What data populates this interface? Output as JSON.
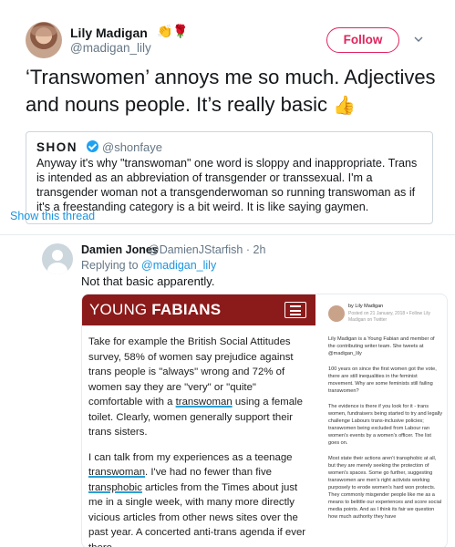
{
  "tweet": {
    "author_name": "Lily Madigan",
    "author_emoji": "👏🌹",
    "author_handle": "@madigan_lily",
    "follow_label": "Follow",
    "text": "‘Transwomen’ annoys me so much. Adjectives and nouns people. It’s really basic",
    "text_emoji": "👍"
  },
  "quote": {
    "name": "SHON",
    "handle": "@shonfaye",
    "text": "Anyway it's why \"transwoman\" one word is sloppy and inappropriate. Trans is intended as an abbreviation of transgender or transsexual. I'm a transgender woman not a transgenderwoman so running transwoman as if it's a freestanding category is a bit weird. It is like saying gaymen.",
    "show_thread": "Show this thread"
  },
  "reply": {
    "name": "Damien Jones",
    "handle": "@DamienJStarfish · 2h",
    "replying_prefix": "Replying to",
    "replying_handle": "@madigan_lily",
    "text": "Not that basic apparently."
  },
  "media": {
    "logo_light": "YOUNG ",
    "logo_bold": "FABIANS",
    "p1_a": "Take for example the British Social Attitudes survey, 58% of women say prejudice against trans people is \"always\" wrong and 72% of women say they are \"very\" or \"quite\" comfortable with a ",
    "p1_ul": "transwoman",
    "p1_b": " using a female toilet. Clearly, women generally support their trans sisters.",
    "p2_a": "I can talk from my experiences as a teenage ",
    "p2_ul1": "transwoman",
    "p2_b": ". I've had no fewer than five ",
    "p2_ul2": "transphobic",
    "p2_c": " articles from the Times about just me in a single week, with many more directly vicious articles from other news sites over the past year. A concerted anti-trans agenda if ever there",
    "sb_by": "by Lily Madigan",
    "sb_meta": "Posted on 21 January, 2018 • Follow Lily Madigan on Twitter",
    "sb_p1": "Lily Madigan is a Young Fabian and member of the contributing writer team. She tweets at @madigan_lily",
    "sb_p2": "100 years on since the first women got the vote, there are still inequalities in the feminist movement. Why are some feminists still failing transwomen?",
    "sb_p3": "The evidence is there if you look for it - trans women, fundraisers being started to try and legally challenge Labours trans-inclusive policies; transwomen being excluded from Labour ran women's events by a women's officer. The list goes on.",
    "sb_p4": "Most state their actions aren't transphobic at all, but they are merely seeking the protection of women's spaces. Some go further, suggesting transwomen are men's right activists working purposely to erode women's hard won protects. They commonly misgender people like me as a means to belittle our experiences and score social media points. And as I think its fair we question how much authority they have"
  },
  "colors": {
    "follow": "#e0245e",
    "link": "#1b95e0",
    "fabians_red": "#8b1a1a",
    "underline": "#2a9fd6"
  },
  "icons": [
    "chevron-down-icon",
    "verified-icon",
    "menu-icon",
    "thumbs-up-emoji"
  ]
}
